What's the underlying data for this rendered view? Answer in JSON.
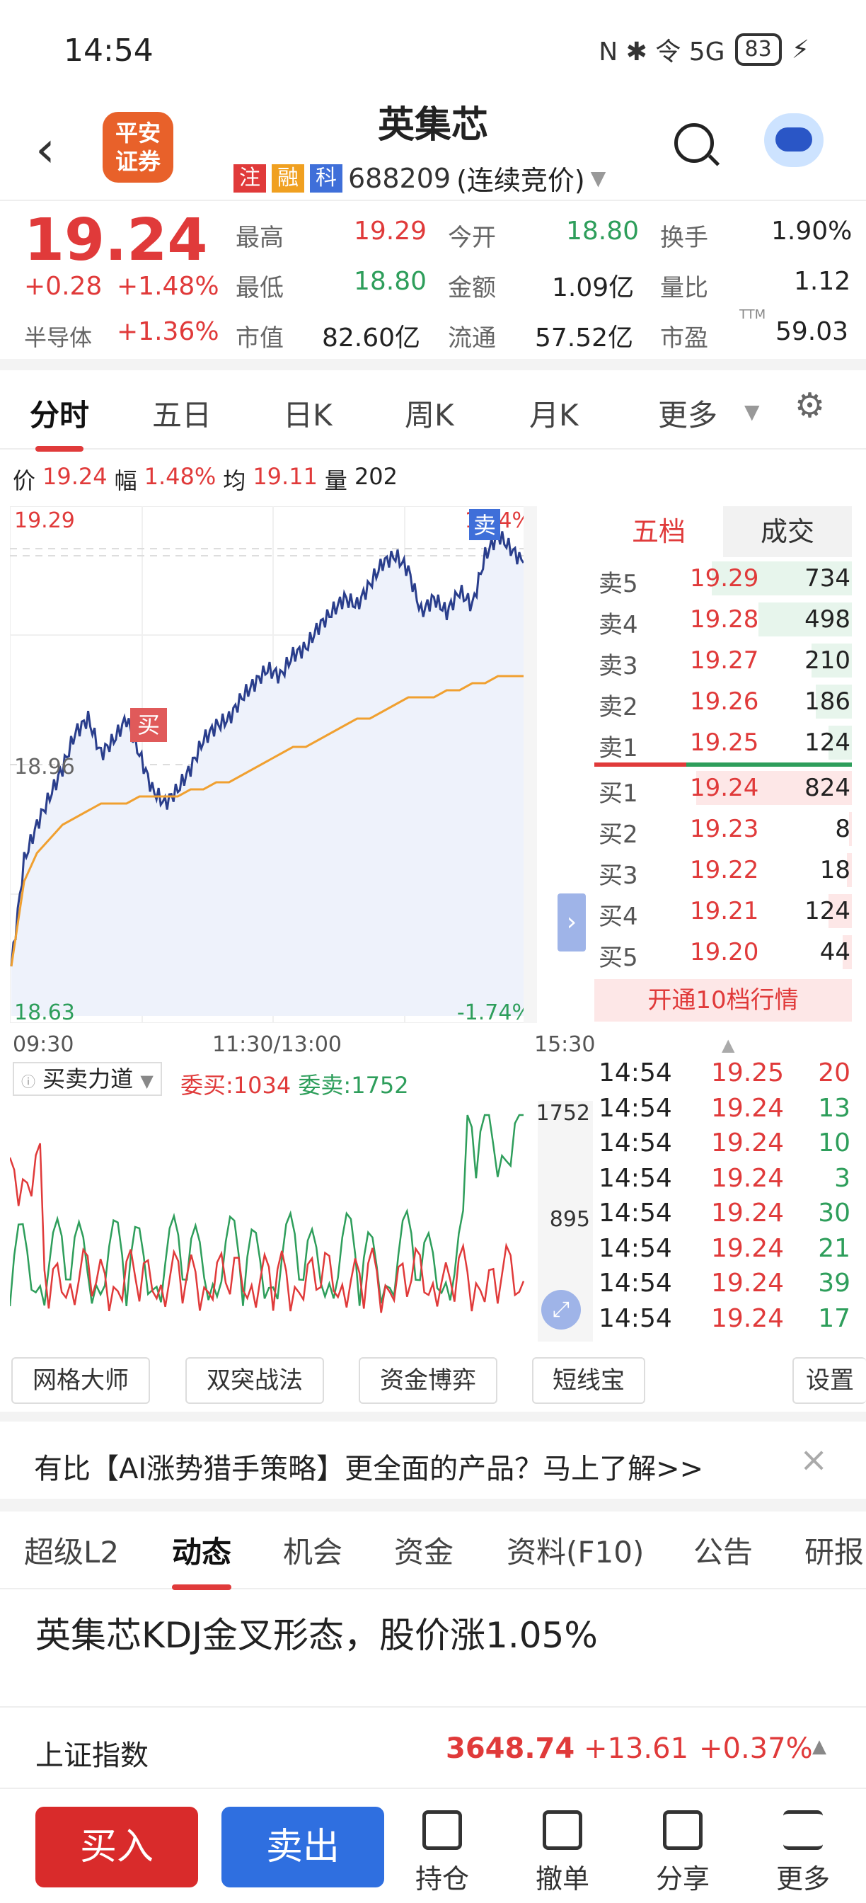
{
  "status": {
    "time": "14:54",
    "icons": "N ✱ 令 5G",
    "battery": "83"
  },
  "header": {
    "title": "英集芯",
    "logo": "平安\n证券",
    "tags": [
      "注",
      "融",
      "科"
    ],
    "code": "688209",
    "mode": "(连续竞价)",
    "colors": {
      "tag_zhu": "#e03a3a",
      "tag_rong": "#f0a020",
      "tag_ke": "#3f6fd9"
    }
  },
  "quote": {
    "price": "19.24",
    "change": "+0.28",
    "change_pct": "+1.48%",
    "sector": "半导体",
    "sector_pct": "+1.36%",
    "stats": [
      {
        "label": "最高",
        "value": "19.29"
      },
      {
        "label": "今开",
        "value": "18.80"
      },
      {
        "label": "换手",
        "value": "1.90%"
      },
      {
        "label": "最低",
        "value": "18.80"
      },
      {
        "label": "金额",
        "value": "1.09亿"
      },
      {
        "label": "量比",
        "value": "1.12"
      },
      {
        "label": "市值",
        "value": "82.60亿"
      },
      {
        "label": "流通",
        "value": "57.52亿"
      },
      {
        "label": "市盈",
        "value": "59.03"
      }
    ],
    "ttm": "TTM"
  },
  "tabs": [
    "分时",
    "五日",
    "日K",
    "周K",
    "月K",
    "更多"
  ],
  "price_info": {
    "l_price": "价",
    "price": "19.24",
    "l_amp": "幅",
    "amp": "1.48%",
    "l_avg": "均",
    "avg": "19.11",
    "l_vol": "量",
    "vol": "202"
  },
  "chart": {
    "ymax": "19.29",
    "ymin": "18.63",
    "pct_max": "1.74%",
    "pct_min": "-1.74%",
    "mid": "18.96",
    "buy_mark": "买",
    "sell_mark": "卖",
    "t_start": "09:30",
    "t_mid": "11:30/13:00",
    "t_end": "15:30"
  },
  "chart_data": {
    "type": "line",
    "series": [
      {
        "values": [
          18.7,
          18.85,
          18.9,
          18.94,
          18.98,
          19.03,
          19.05,
          19.0,
          19.02,
          19.05,
          19.0,
          18.95,
          18.93,
          18.95,
          18.98,
          19.02,
          19.04,
          19.05,
          19.08,
          19.1,
          19.12,
          19.11,
          19.14,
          19.15,
          19.18,
          19.2,
          19.22,
          19.21,
          19.24,
          19.27,
          19.28,
          19.26,
          19.2,
          19.22,
          19.2,
          19.23,
          19.21,
          19.28,
          19.31,
          19.29,
          19.27
        ]
      },
      {
        "values": [
          18.7,
          18.82,
          18.86,
          18.88,
          18.9,
          18.91,
          18.92,
          18.93,
          18.93,
          18.93,
          18.94,
          18.94,
          18.94,
          18.94,
          18.95,
          18.95,
          18.96,
          18.96,
          18.97,
          18.98,
          18.99,
          19.0,
          19.01,
          19.01,
          19.02,
          19.03,
          19.04,
          19.05,
          19.05,
          19.06,
          19.07,
          19.08,
          19.08,
          19.08,
          19.09,
          19.09,
          19.1,
          19.1,
          19.11,
          19.11,
          19.11
        ]
      }
    ],
    "ylim": [
      18.63,
      19.29
    ]
  },
  "orderbook": {
    "tab_a": "五档",
    "tab_b": "成交",
    "asks": [
      {
        "label": "卖5",
        "price": "19.29",
        "vol": "734",
        "ratio": 0.9
      },
      {
        "label": "卖4",
        "price": "19.28",
        "vol": "498",
        "ratio": 0.6
      },
      {
        "label": "卖3",
        "price": "19.27",
        "vol": "210",
        "ratio": 0.26
      },
      {
        "label": "卖2",
        "price": "19.26",
        "vol": "186",
        "ratio": 0.23
      },
      {
        "label": "卖1",
        "price": "19.25",
        "vol": "124",
        "ratio": 0.15
      }
    ],
    "bids": [
      {
        "label": "买1",
        "price": "19.24",
        "vol": "824",
        "ratio": 1.0
      },
      {
        "label": "买2",
        "price": "19.23",
        "vol": "8",
        "ratio": 0.02
      },
      {
        "label": "买3",
        "price": "19.22",
        "vol": "18",
        "ratio": 0.03
      },
      {
        "label": "买4",
        "price": "19.21",
        "vol": "124",
        "ratio": 0.15
      },
      {
        "label": "买5",
        "price": "19.20",
        "vol": "44",
        "ratio": 0.06
      }
    ],
    "open10": "开通10档行情"
  },
  "force": {
    "title": "买卖力道",
    "buy_label": "委买:",
    "buy": "1034",
    "sell_label": "委卖:",
    "sell": "1752",
    "ymax": "1752",
    "ymid": "895"
  },
  "ticks": [
    {
      "t": "14:54",
      "p": "19.25",
      "v": "20",
      "up": true
    },
    {
      "t": "14:54",
      "p": "19.24",
      "v": "13",
      "up": false
    },
    {
      "t": "14:54",
      "p": "19.24",
      "v": "10",
      "up": false
    },
    {
      "t": "14:54",
      "p": "19.24",
      "v": "3",
      "up": false
    },
    {
      "t": "14:54",
      "p": "19.24",
      "v": "30",
      "up": false
    },
    {
      "t": "14:54",
      "p": "19.24",
      "v": "21",
      "up": false
    },
    {
      "t": "14:54",
      "p": "19.24",
      "v": "39",
      "up": false
    },
    {
      "t": "14:54",
      "p": "19.24",
      "v": "17",
      "up": false
    }
  ],
  "tools": [
    "网格大师",
    "双突战法",
    "资金博弈",
    "短线宝",
    "设置"
  ],
  "ad": {
    "text": "有比【AI涨势猎手策略】更全面的产品？马上了解>>"
  },
  "news_tabs": [
    "超级L2",
    "动态",
    "机会",
    "资金",
    "资料(F10)",
    "公告",
    "研报"
  ],
  "news": {
    "headline": "英集芯KDJ金叉形态，股价涨1.05%"
  },
  "index": {
    "name": "上证指数",
    "value": "3648.74",
    "change": "+13.61",
    "pct": "+0.37%"
  },
  "bottom": {
    "buy": "买入",
    "sell": "卖出",
    "hold": "持仓",
    "cancel": "撤单",
    "share": "分享",
    "more": "更多"
  }
}
